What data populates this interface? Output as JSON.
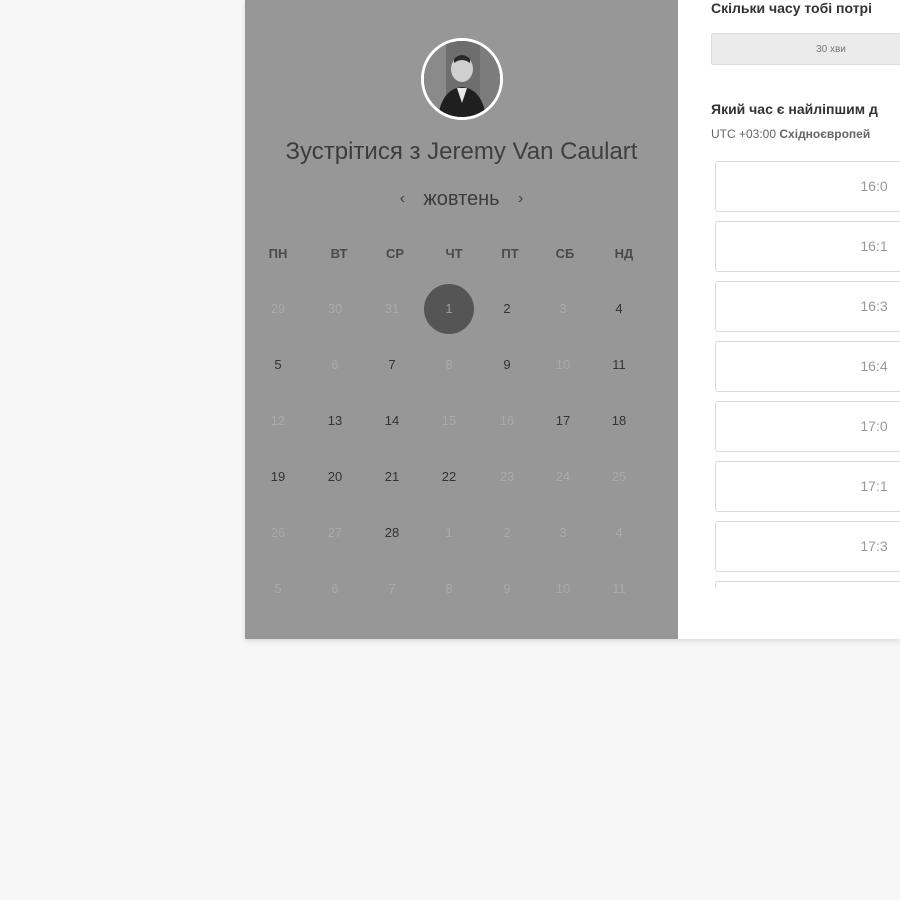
{
  "meeting": {
    "title_prefix": "Зустрітися з",
    "name": "Jeremy Van Caulart"
  },
  "calendar": {
    "month": "жовтень",
    "prev_icon": "chevron-left-icon",
    "next_icon": "chevron-right-icon",
    "weekdays": [
      "ПН",
      "ВТ",
      "СР",
      "ЧТ",
      "ПТ",
      "СБ",
      "НД"
    ],
    "selected_day": "1",
    "weeks": [
      [
        {
          "d": "29",
          "s": "dim"
        },
        {
          "d": "30",
          "s": "dim"
        },
        {
          "d": "31",
          "s": "dim"
        },
        {
          "d": "1",
          "s": "selected"
        },
        {
          "d": "2",
          "s": "avail"
        },
        {
          "d": "3",
          "s": "dim"
        },
        {
          "d": "4",
          "s": "avail"
        }
      ],
      [
        {
          "d": "5",
          "s": "avail"
        },
        {
          "d": "6",
          "s": "dim"
        },
        {
          "d": "7",
          "s": "avail"
        },
        {
          "d": "8",
          "s": "dim"
        },
        {
          "d": "9",
          "s": "avail"
        },
        {
          "d": "10",
          "s": "dim"
        },
        {
          "d": "11",
          "s": "avail"
        }
      ],
      [
        {
          "d": "12",
          "s": "dim"
        },
        {
          "d": "13",
          "s": "avail"
        },
        {
          "d": "14",
          "s": "avail"
        },
        {
          "d": "15",
          "s": "dim"
        },
        {
          "d": "16",
          "s": "dim"
        },
        {
          "d": "17",
          "s": "avail"
        },
        {
          "d": "18",
          "s": "avail"
        }
      ],
      [
        {
          "d": "19",
          "s": "avail"
        },
        {
          "d": "20",
          "s": "avail"
        },
        {
          "d": "21",
          "s": "avail"
        },
        {
          "d": "22",
          "s": "avail"
        },
        {
          "d": "23",
          "s": "dim"
        },
        {
          "d": "24",
          "s": "dim"
        },
        {
          "d": "25",
          "s": "dim"
        }
      ],
      [
        {
          "d": "26",
          "s": "dim"
        },
        {
          "d": "27",
          "s": "dim"
        },
        {
          "d": "28",
          "s": "avail"
        },
        {
          "d": "1",
          "s": "dim"
        },
        {
          "d": "2",
          "s": "dim"
        },
        {
          "d": "3",
          "s": "dim"
        },
        {
          "d": "4",
          "s": "dim"
        }
      ],
      [
        {
          "d": "5",
          "s": "dim"
        },
        {
          "d": "6",
          "s": "dim"
        },
        {
          "d": "7",
          "s": "dim"
        },
        {
          "d": "8",
          "s": "dim"
        },
        {
          "d": "9",
          "s": "dim"
        },
        {
          "d": "10",
          "s": "dim"
        },
        {
          "d": "11",
          "s": "dim"
        }
      ]
    ]
  },
  "booking": {
    "duration_question": "Скільки часу тобі потрі",
    "duration_value": "30 хви",
    "time_question": "Який час є найліпшим д",
    "timezone_offset": "UTC +03:00",
    "timezone_name": "Східноєвропей",
    "slots": [
      "16:0",
      "16:1",
      "16:3",
      "16:4",
      "17:0",
      "17:1",
      "17:3",
      ""
    ]
  },
  "colors": {
    "page_bg": "#f7f7f7",
    "overlay": "#979797",
    "selected_day": "#555555"
  }
}
